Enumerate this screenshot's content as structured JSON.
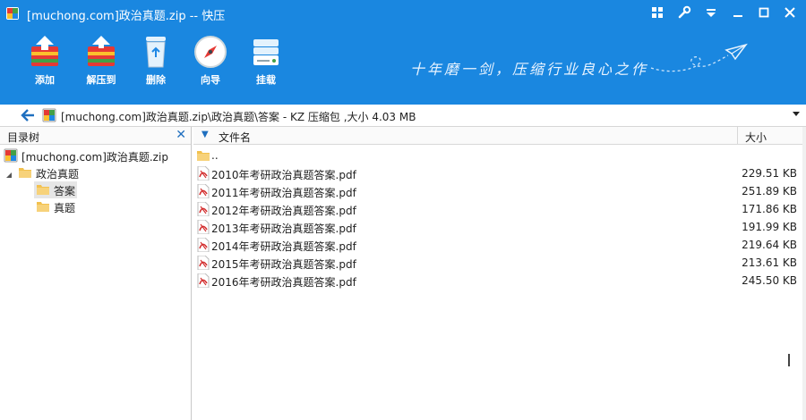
{
  "window": {
    "title": "[muchong.com]政治真题.zip -- 快压"
  },
  "toolbar": {
    "items": [
      {
        "label": "添加",
        "icon": "add-archive-icon"
      },
      {
        "label": "解压到",
        "icon": "extract-icon"
      },
      {
        "label": "删除",
        "icon": "recycle-bin-icon"
      },
      {
        "label": "向导",
        "icon": "compass-icon"
      },
      {
        "label": "挂载",
        "icon": "drive-mount-icon"
      }
    ],
    "slogan": "十年磨一剑，压缩行业良心之作"
  },
  "path": {
    "text": "[muchong.com]政治真题.zip\\政治真题\\答案 - KZ 压缩包 ,大小 4.03 MB"
  },
  "tree": {
    "title": "目录树",
    "nodes": [
      {
        "label": "[muchong.com]政治真题.zip",
        "type": "archive"
      },
      {
        "label": "政治真题",
        "type": "folder"
      },
      {
        "label": "答案",
        "type": "folder",
        "selected": true
      },
      {
        "label": "真题",
        "type": "folder"
      }
    ]
  },
  "list": {
    "col_name": "文件名",
    "col_size": "大小",
    "rows": [
      {
        "name": "..",
        "size": "",
        "type": "folder"
      },
      {
        "name": "2010年考研政治真题答案.pdf",
        "size": "229.51 KB",
        "type": "pdf"
      },
      {
        "name": "2011年考研政治真题答案.pdf",
        "size": "251.89 KB",
        "type": "pdf"
      },
      {
        "name": "2012年考研政治真题答案.pdf",
        "size": "171.86 KB",
        "type": "pdf"
      },
      {
        "name": "2013年考研政治真题答案.pdf",
        "size": "191.99 KB",
        "type": "pdf"
      },
      {
        "name": "2014年考研政治真题答案.pdf",
        "size": "219.64 KB",
        "type": "pdf"
      },
      {
        "name": "2015年考研政治真题答案.pdf",
        "size": "213.61 KB",
        "type": "pdf"
      },
      {
        "name": "2016年考研政治真题答案.pdf",
        "size": "245.50 KB",
        "type": "pdf"
      }
    ]
  },
  "colors": {
    "accent": "#1a87e0",
    "pdf_red": "#d32f2f",
    "folder": "#f2c14e"
  }
}
